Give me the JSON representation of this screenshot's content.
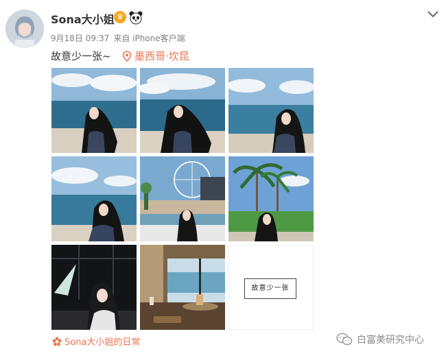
{
  "post": {
    "username": "Sona大小姐",
    "time": "9月18日 09:37",
    "client": "来自 iPhone客户端",
    "text": "故意少一张~",
    "location": "墨西哥·坎昆",
    "source": "Sona大小姐的日常",
    "placeholder_label": "故意少一张"
  },
  "icons": {
    "badge": "crown-badge-icon",
    "badge2": "panda-icon",
    "menu": "chevron-down-icon",
    "location": "location-pin-icon",
    "source": "weibo-flower-icon",
    "watermark": "wechat-icon"
  },
  "watermark": {
    "text": "白富美研究中心"
  },
  "colors": {
    "accent": "#eb7350",
    "meta": "#808080",
    "text": "#333333"
  }
}
